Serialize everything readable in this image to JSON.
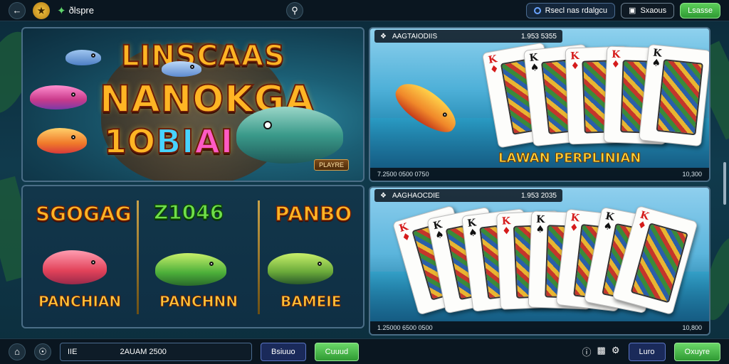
{
  "topbar": {
    "back_icon": "back-arrow-icon",
    "logo_icon": "game-logo-icon",
    "brand_label": "ðlspre",
    "search_icon": "search-icon",
    "account_label": "Rsecl nas rdalgcu",
    "secondary_label": "Sxaous",
    "action_label": "Lsasse"
  },
  "main_banner": {
    "line1": "LINSCAAS",
    "line2": "NANOKGA",
    "line3a": "1O",
    "line3b": "BI",
    "line3c": "AI",
    "badge": "PLAYRE"
  },
  "strip": {
    "sections": [
      {
        "title": "SGOGAG",
        "label": "PANCHIAN"
      },
      {
        "title": "Z1046",
        "label": "PANCHNN"
      },
      {
        "title": "PANBO",
        "label": "BAMEIE"
      }
    ]
  },
  "right_top": {
    "header_left": "AAGTAIODIIS",
    "header_value": "1.953 5355",
    "promo": "LAWAN PERPLINIAN",
    "footer_left": "7.2500 0500 0750",
    "footer_right": "10,300"
  },
  "right_bottom": {
    "header_left": "AAGHAOCDIE",
    "header_value": "1.953 2035",
    "footer_left": "1.25000 6500 0500",
    "footer_right": "10,800"
  },
  "cards_top": [
    {
      "rank": "K",
      "suit": "♦",
      "color": "red"
    },
    {
      "rank": "K",
      "suit": "♠",
      "color": "blk"
    },
    {
      "rank": "K",
      "suit": "♦",
      "color": "red"
    },
    {
      "rank": "K",
      "suit": "♦",
      "color": "red"
    },
    {
      "rank": "K",
      "suit": "♠",
      "color": "blk"
    }
  ],
  "cards_bottom": [
    {
      "rank": "K",
      "suit": "♦",
      "color": "red"
    },
    {
      "rank": "K",
      "suit": "♠",
      "color": "blk"
    },
    {
      "rank": "K",
      "suit": "♠",
      "color": "blk"
    },
    {
      "rank": "K",
      "suit": "♦",
      "color": "red"
    },
    {
      "rank": "K",
      "suit": "♠",
      "color": "blk"
    },
    {
      "rank": "K",
      "suit": "♦",
      "color": "red"
    },
    {
      "rank": "K",
      "suit": "♠",
      "color": "blk"
    },
    {
      "rank": "K",
      "suit": "♦",
      "color": "red"
    }
  ],
  "bottombar": {
    "home_icon": "home-icon",
    "shield_icon": "shield-icon",
    "field_left": "IIE",
    "field_value": "2AUAM 2500",
    "btn1": "Bsiuuo",
    "btn2": "Cuuud",
    "btn3": "Luro",
    "btn4": "Oxuyre"
  },
  "colors": {
    "accent_green": "#4caf50",
    "accent_gold": "#ffb524",
    "panel_border": "#4a6d86"
  }
}
